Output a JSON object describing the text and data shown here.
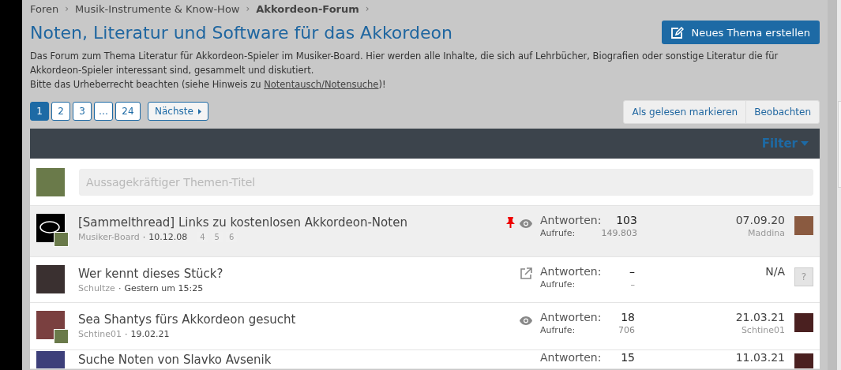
{
  "breadcrumb": [
    {
      "label": "Foren",
      "current": false
    },
    {
      "label": "Musik-Instrumente & Know-How",
      "current": false
    },
    {
      "label": "Akkordeon-Forum",
      "current": true
    }
  ],
  "breadcrumb_separator": "›",
  "forum": {
    "title": "Noten, Literatur und Software für das Akkordeon",
    "description": "Das Forum zum Thema Literatur für Akkordeon-Spieler im Musiker-Board. Hier werden alle Inhalte, die sich auf Lehrbücher, Biografien oder sonstige Literatur die für Akkordeon-Spieler interessant sind, gesammelt und diskutiert.",
    "notice_before": "Bitte das Urheberrecht beachten (siehe Hinweis zu ",
    "notice_link": "Notentausch/Notensuche",
    "notice_after": ")!"
  },
  "new_thread_button": "Neues Thema erstellen",
  "pagination": {
    "pages": [
      {
        "label": "1",
        "selected": true
      },
      {
        "label": "2",
        "selected": false
      },
      {
        "label": "3",
        "selected": false
      },
      {
        "label": "…",
        "selected": false
      },
      {
        "label": "24",
        "selected": false
      }
    ],
    "next": "Nächste"
  },
  "actions": [
    "Als gelesen markieren",
    "Beobachten"
  ],
  "filter": "Filter",
  "quick_thread": {
    "placeholder": "Aussagekräftiger Themen-Titel"
  },
  "meta_separator": "·",
  "threads": [
    {
      "title": "[Sammelthread] Links zu kostenlosen Akkordeon-Noten",
      "author": "Musiker-Board",
      "date": "10.12.08",
      "pages": [
        "4",
        "5",
        "6"
      ],
      "sticky": true,
      "watched": true,
      "redirect": false,
      "highlighted": true,
      "replies_label": "Antworten:",
      "replies": "103",
      "views_label": "Aufrufe:",
      "views": "149.803",
      "last_date": "07.09.20",
      "last_user": "Maddina",
      "avatar": {
        "kind": "logo"
      },
      "small_avatar": true,
      "last_avatar": {
        "kind": "photo"
      }
    },
    {
      "title": "Wer kennt dieses Stück?",
      "author": "Schultze",
      "date": "Gestern um 15:25",
      "sticky": false,
      "watched": false,
      "redirect": true,
      "highlighted": false,
      "replies_label": "Antworten:",
      "replies": "–",
      "views_label": "Aufrufe:",
      "views": "–",
      "last_date": "N/A",
      "avatar": {
        "kind": "photo"
      },
      "small_avatar": false,
      "last_avatar": {
        "kind": "unknown",
        "text": "?"
      }
    },
    {
      "title": "Sea Shantys fürs Akkordeon gesucht",
      "author": "Schtine01",
      "date": "19.02.21",
      "sticky": false,
      "watched": true,
      "redirect": false,
      "highlighted": false,
      "replies_label": "Antworten:",
      "replies": "18",
      "views_label": "Aufrufe:",
      "views": "706",
      "last_date": "21.03.21",
      "last_user": "Schtine01",
      "avatar": {
        "kind": "photo"
      },
      "small_avatar": true,
      "last_avatar": {
        "kind": "photo"
      }
    },
    {
      "title": "Suche Noten von Slavko Avsenik",
      "sticky": false,
      "watched": false,
      "redirect": false,
      "highlighted": false,
      "replies_label": "Antworten:",
      "replies": "15",
      "last_date": "11.03.21",
      "avatar": {
        "kind": "letter"
      },
      "small_avatar": false,
      "last_avatar": {
        "kind": "photo"
      }
    }
  ]
}
